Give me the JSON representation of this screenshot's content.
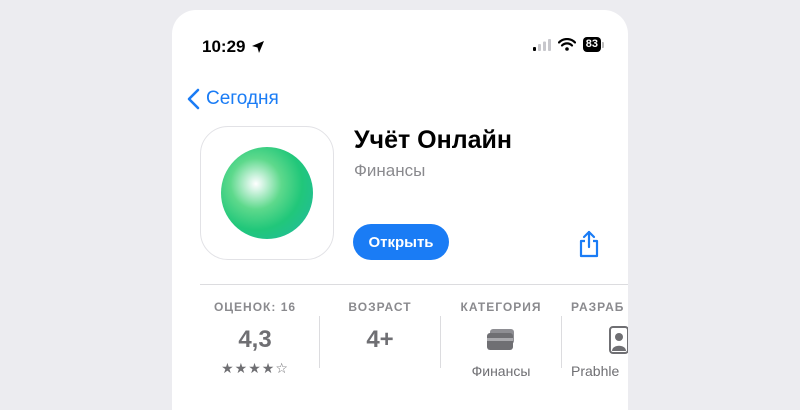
{
  "status_bar": {
    "time": "10:29",
    "battery": "83"
  },
  "nav": {
    "back_label": "Сегодня"
  },
  "app": {
    "name": "Учёт Онлайн",
    "category": "Финансы",
    "open_label": "Открыть"
  },
  "info": [
    {
      "label": "ОЦЕНОК: 16",
      "value": "4,3",
      "stars": "★★★★☆"
    },
    {
      "label": "ВОЗРАСТ",
      "value": "4+"
    },
    {
      "label": "КАТЕГОРИЯ",
      "sub": "Финансы"
    },
    {
      "label": "РАЗРАБ",
      "sub": "Prabhle"
    }
  ],
  "colors": {
    "accent": "#1a7cf5",
    "secondary_text": "#8a8a8e"
  }
}
